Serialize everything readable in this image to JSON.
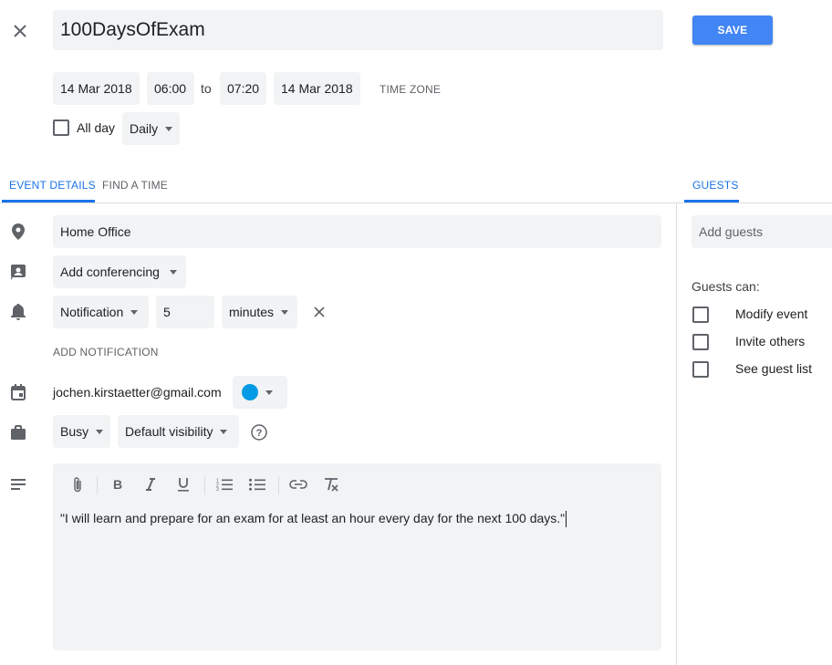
{
  "header": {
    "title": "100DaysOfExam",
    "save_label": "SAVE"
  },
  "datetime": {
    "start_date": "14 Mar 2018",
    "start_time": "06:00",
    "to_label": "to",
    "end_time": "07:20",
    "end_date": "14 Mar 2018",
    "timezone_label": "TIME ZONE",
    "all_day_label": "All day",
    "repeat_value": "Daily"
  },
  "tabs": {
    "event_details": "EVENT DETAILS",
    "find_a_time": "FIND A TIME",
    "guests": "GUESTS"
  },
  "details": {
    "location": "Home Office",
    "conferencing": "Add conferencing",
    "notification_type": "Notification",
    "notification_value": "5",
    "notification_unit": "minutes",
    "add_notification": "ADD NOTIFICATION",
    "calendar_owner": "jochen.kirstaetter@gmail.com",
    "calendar_color": "#039be5",
    "availability": "Busy",
    "visibility": "Default visibility",
    "description": "\"I will learn and prepare for an exam for at least an hour every day for the next 100 days.\""
  },
  "guests": {
    "placeholder": "Add guests",
    "permissions_title": "Guests can:",
    "permissions": [
      {
        "label": "Modify event",
        "checked": false
      },
      {
        "label": "Invite others",
        "checked": false
      },
      {
        "label": "See guest list",
        "checked": false
      }
    ]
  },
  "colors": {
    "accent": "#4285f4",
    "tab_active": "#1a73e8",
    "field_bg": "#f1f3f4"
  }
}
